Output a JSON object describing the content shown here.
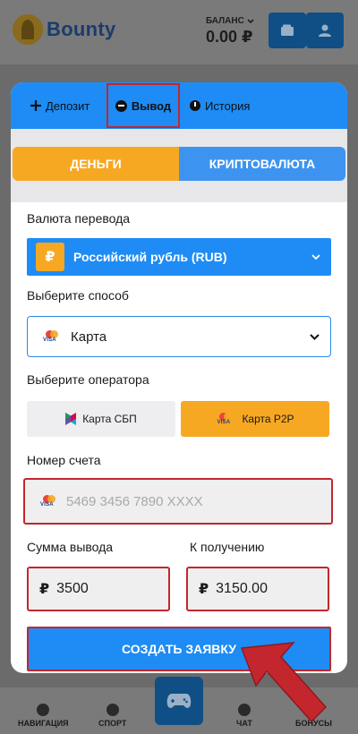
{
  "header": {
    "brand": "Bounty",
    "balance_label": "БАЛАНС",
    "balance_amount": "0.00 ₽"
  },
  "modal": {
    "tabs": [
      {
        "label": "Депозит",
        "icon": "plus-icon"
      },
      {
        "label": "Вывод",
        "icon": "minus-circle-icon",
        "active": true
      },
      {
        "label": "История",
        "icon": "clock-icon"
      }
    ],
    "payment_types": [
      "ДЕНЬГИ",
      "КРИПТОВАЛЮТА"
    ],
    "currency_label": "Валюта перевода",
    "currency_symbol": "₽",
    "currency_value": "Российский рубль (RUB)",
    "method_label": "Выберите способ",
    "method_value": "Карта",
    "operator_label": "Выберите оператора",
    "operators": [
      "Карта СБП",
      "Карта P2P"
    ],
    "selected_operator": "Карта P2P",
    "account_label": "Номер счета",
    "account_placeholder": "5469 3456 7890 XXXX",
    "withdraw_amount_label": "Сумма вывода",
    "receive_label": "К получению",
    "withdraw_amount": "3500",
    "receive_amount": "3150.00",
    "rub_sign": "₽",
    "submit_label": "СОЗДАТЬ ЗАЯВКУ"
  },
  "bottom_nav": {
    "items": [
      "НАВИГАЦИЯ",
      "СПОРТ",
      "ЧАТ",
      "БОНУСЫ"
    ]
  },
  "colors": {
    "primary_blue": "#1e8cf4",
    "accent_orange": "#f7a823",
    "highlight_red": "#c4262e"
  }
}
